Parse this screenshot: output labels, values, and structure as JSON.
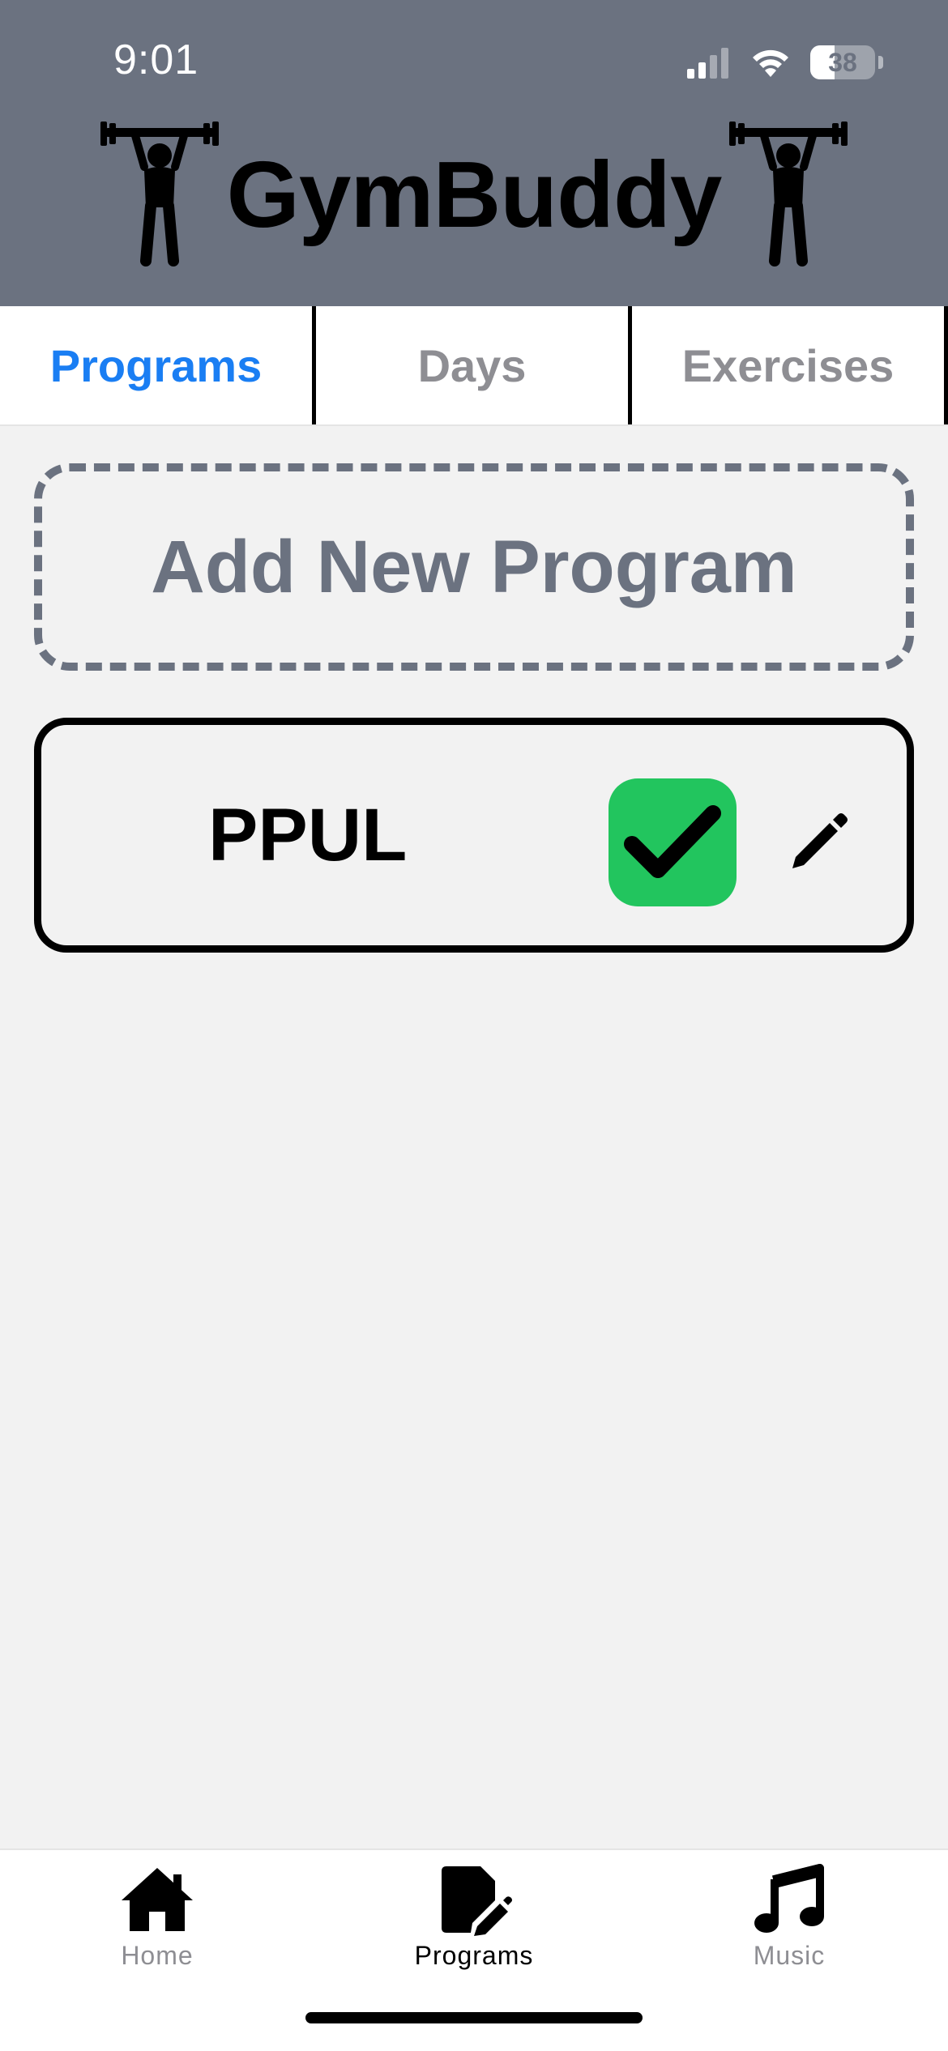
{
  "status_bar": {
    "time": "9:01",
    "battery_level": "38",
    "battery_fraction": 0.38,
    "signal_icon": "cellular-signal-icon",
    "wifi_icon": "wifi-icon"
  },
  "header": {
    "title": "GymBuddy",
    "left_icon": "weightlifter-icon",
    "right_icon": "weightlifter-icon"
  },
  "tabs": [
    {
      "label": "Programs",
      "active": true
    },
    {
      "label": "Days",
      "active": false
    },
    {
      "label": "Exercises",
      "active": false
    }
  ],
  "add_program": {
    "label": "Add New Program"
  },
  "programs": [
    {
      "name": "PPUL",
      "active": true,
      "active_icon": "checkmark-icon",
      "edit_icon": "pencil-icon"
    }
  ],
  "tabbar": {
    "items": [
      {
        "label": "Home",
        "icon": "house-icon",
        "active": false
      },
      {
        "label": "Programs",
        "icon": "edit-document-icon",
        "active": true
      },
      {
        "label": "Music",
        "icon": "music-note-icon",
        "active": false
      }
    ]
  },
  "colors": {
    "header_bg": "#6b7280",
    "accent": "#1a7ef3",
    "active_badge": "#22c55e",
    "muted": "#8e8e93",
    "page_bg": "#f2f2f2"
  }
}
